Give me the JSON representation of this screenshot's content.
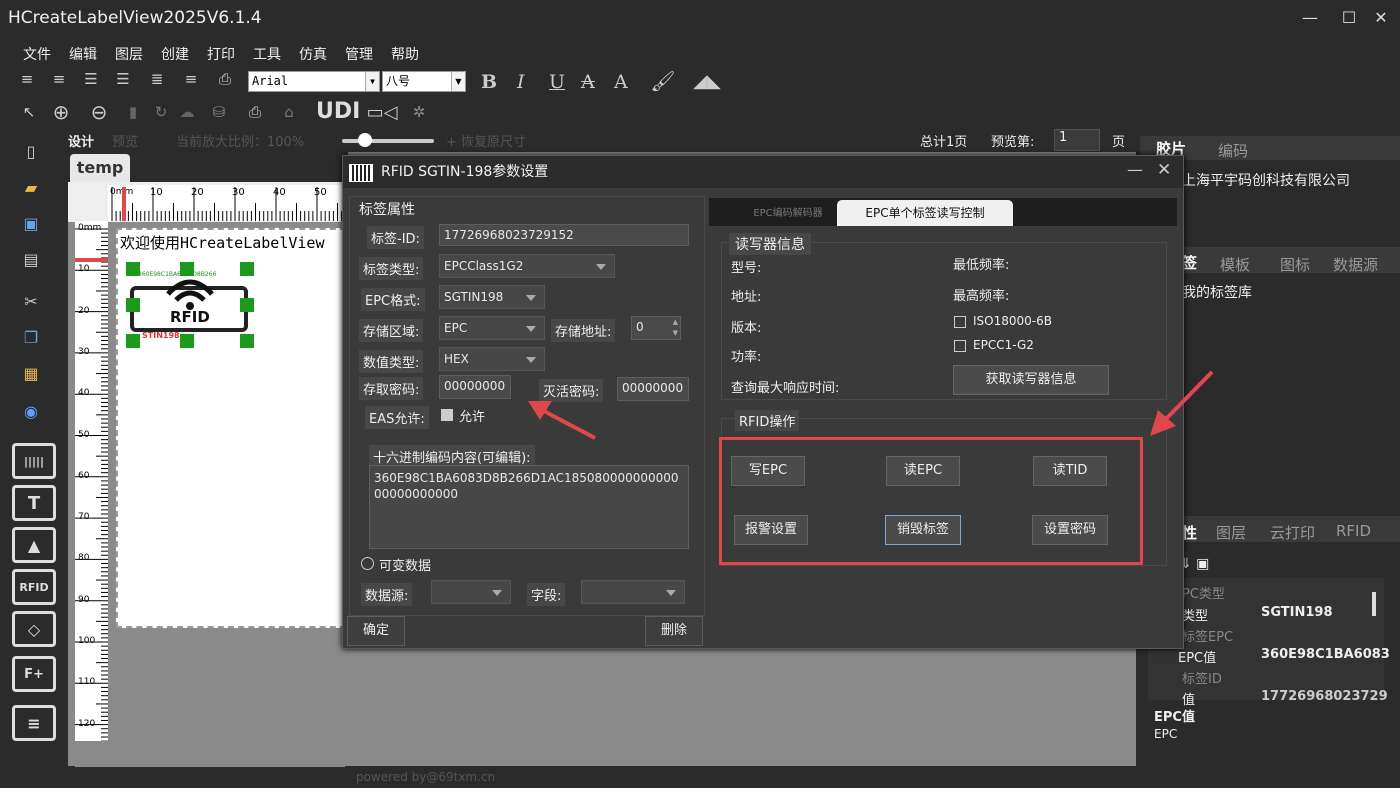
{
  "window": {
    "title": "HCreateLabelView2025V6.1.4"
  },
  "menu": [
    "文件",
    "编辑",
    "图层",
    "创建",
    "打印",
    "工具",
    "仿真",
    "管理",
    "帮助"
  ],
  "toolbar": {
    "font_name": "Arial",
    "font_size": "八号",
    "bold": "B",
    "italic": "I",
    "underline": "U",
    "strike": "A",
    "font_a": "A",
    "udi": "UDI"
  },
  "design_bar": {
    "mode_design": "设计",
    "mode_preview": "预览",
    "zoom_text": "当前放大比例：100%",
    "restore": "+ 恢复原尺寸",
    "total_pages": "总计1页",
    "preview_label": "预览第:",
    "page_value": "1",
    "page_unit": "页",
    "zoom_slider_level": 0.2
  },
  "doc_tab": "temp",
  "canvas": {
    "welcome": "欢迎使用HCreateLabelView",
    "ruler_top": [
      "0mm",
      "10",
      "20",
      "30",
      "40",
      "50"
    ],
    "ruler_left": [
      "0mm",
      "10",
      "20",
      "30",
      "40",
      "50",
      "60",
      "70",
      "80",
      "90",
      "100",
      "110",
      "120"
    ],
    "rfid_text": "RFID",
    "footer": "powered by@69txm.cn"
  },
  "dialog": {
    "title": "RFID SGTIN-198参数设置",
    "tag_props": {
      "group": "标签属性",
      "tag_id_label": "标签-ID:",
      "tag_id": "17726968023729152",
      "tag_type_label": "标签类型:",
      "tag_type": "EPCClass1G2",
      "epc_format_label": "EPC格式:",
      "epc_format": "SGTIN198",
      "storage_area_label": "存储区域:",
      "storage_area": "EPC",
      "storage_addr_label": "存储地址:",
      "storage_addr": "0",
      "value_type_label": "数值类型:",
      "value_type": "HEX",
      "access_pwd_label": "存取密码:",
      "access_pwd": "00000000",
      "kill_pwd_label": "灭活密码:",
      "kill_pwd": "00000000",
      "eas_label": "EAS允许:",
      "eas_check": "允许",
      "hex_label": "十六进制编码内容(可编辑):",
      "hex_value": "360E98C1BA6083D8B266D1AC18508000000000000000000000",
      "variable_data": "可变数据",
      "datasource_label": "数据源:",
      "field_label": "字段:"
    },
    "ok_button": "确定",
    "delete_button": "删除",
    "tabs": [
      "EPC编码解码器",
      "EPC单个标签读写控制"
    ],
    "reader": {
      "group": "读写器信息",
      "model": "型号:",
      "address": "地址:",
      "version": "版本:",
      "power": "功率:",
      "max_resp": "查询最大响应时间:",
      "min_freq": "最低频率:",
      "max_freq": "最高频率:",
      "iso": "ISO18000-6B",
      "epcc1": "EPCC1-G2",
      "get_info": "获取读写器信息"
    },
    "ops": {
      "group": "RFID操作",
      "buttons": [
        "写EPC",
        "读EPC",
        "读TID",
        "报警设置",
        "销毁标签",
        "设置密码"
      ]
    }
  },
  "right_panel": {
    "tabs_top": [
      "胶片",
      "编码"
    ],
    "company": "上海平宇码创科技有限公司",
    "tabs_mid": [
      "签",
      "模板",
      "图标",
      "数据源"
    ],
    "library": "我的标签库",
    "tabs_bottom": [
      "性",
      "图层",
      "云打印",
      "RFID"
    ],
    "props": [
      {
        "k": "PC类型",
        "v": ""
      },
      {
        "k": "类型",
        "v": "SGTIN198"
      },
      {
        "k": "标签EPC",
        "v": ""
      },
      {
        "k": "EPC值",
        "v": "360E98C1BA6083"
      },
      {
        "k": "标签ID",
        "v": ""
      },
      {
        "k": "值",
        "v": "17726968023729"
      }
    ],
    "desc_title": "EPC值",
    "desc_text": "EPC"
  },
  "colors": {
    "accent_red": "#e0474c",
    "bg": "#2b2b2b",
    "dialog": "#3a3a3a"
  }
}
